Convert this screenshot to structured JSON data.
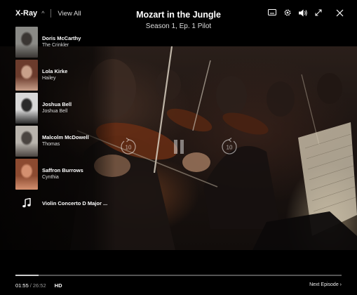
{
  "header": {
    "xray_label": "X-Ray",
    "xray_caret": "^",
    "view_all_label": "View All",
    "show_title": "Mozart in the Jungle",
    "episode_info": "Season 1, Ep. 1 Pilot",
    "controls": [
      "subtitles-icon",
      "settings-icon",
      "volume-icon",
      "fullscreen-icon",
      "close-icon"
    ]
  },
  "xray": {
    "cast": [
      {
        "name": "Doris McCarthy",
        "role": "The Crinkler",
        "photo_colors": [
          "#8a8a86",
          "#3a3633"
        ]
      },
      {
        "name": "Lola Kirke",
        "role": "Hailey",
        "photo_colors": [
          "#6b3b2c",
          "#c8a08a"
        ]
      },
      {
        "name": "Joshua Bell",
        "role": "Joshua Bell",
        "photo_colors": [
          "#d8d8d8",
          "#2a2a2a"
        ]
      },
      {
        "name": "Malcolm McDowell",
        "role": "Thomas",
        "photo_colors": [
          "#b9b4ad",
          "#4a4440"
        ]
      },
      {
        "name": "Saffron Burrows",
        "role": "Cynthia",
        "photo_colors": [
          "#8c4a30",
          "#d49070"
        ]
      }
    ],
    "music": {
      "title": "Violin Concerto D Major ...",
      "icon": "music-note-icon"
    }
  },
  "playback": {
    "skip_back_seconds": "10",
    "skip_forward_seconds": "10",
    "state": "playing",
    "current_time": "01:55",
    "separator": "/",
    "total_time": "26:52",
    "quality": "HD",
    "progress_fraction": 0.071,
    "next_episode_label": "Next Episode ›"
  },
  "colors": {
    "background": "#000000",
    "accent_text": "#ffffff",
    "muted_text": "#999999"
  }
}
